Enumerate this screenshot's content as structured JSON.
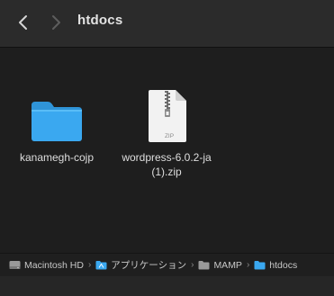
{
  "window": {
    "title": "htdocs"
  },
  "toolbar": {
    "back_icon": "chevron-left-icon",
    "forward_icon": "chevron-right-icon"
  },
  "files": [
    {
      "name": "kanamegh-cojp",
      "kind": "folder",
      "icon": "folder-icon"
    },
    {
      "name": "wordpress-6.0.2-ja (1).zip",
      "kind": "zip",
      "icon": "zip-archive-icon",
      "badge": "ZIP"
    }
  ],
  "pathbar": {
    "items": [
      {
        "label": "Macintosh HD",
        "icon": "hard-drive-icon"
      },
      {
        "label": "アプリケーション",
        "icon": "folder-icon"
      },
      {
        "label": "MAMP",
        "icon": "folder-icon"
      },
      {
        "label": "htdocs",
        "icon": "folder-icon"
      }
    ],
    "separator": "›"
  },
  "colors": {
    "toolbar_bg": "#2b2b2b",
    "content_bg": "#1e1e1e",
    "folder_blue": "#3aa8f0",
    "text": "#dedede"
  }
}
